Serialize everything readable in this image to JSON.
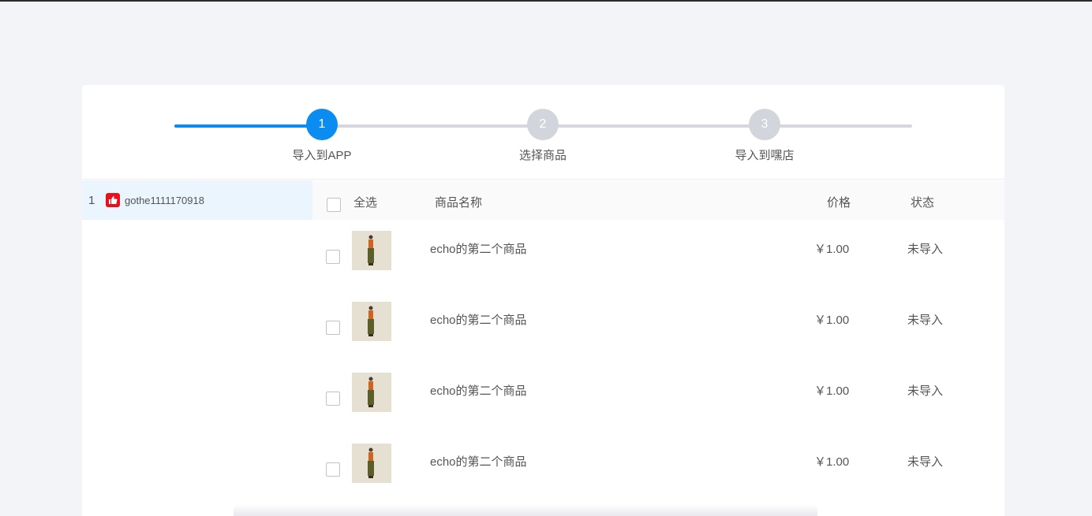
{
  "stepper": {
    "steps": [
      {
        "number": "1",
        "label": "导入到APP",
        "state": "active"
      },
      {
        "number": "2",
        "label": "选择商品",
        "state": "inactive"
      },
      {
        "number": "3",
        "label": "导入到嘿店",
        "state": "inactive"
      }
    ]
  },
  "shops": [
    {
      "index": "1",
      "icon": "thumbs-up-icon",
      "name": "gothe1111170918"
    }
  ],
  "table": {
    "select_all_label": "全选",
    "columns": {
      "name": "商品名称",
      "price": "价格",
      "status": "状态"
    },
    "rows": [
      {
        "name": "echo的第二个商品",
        "price": "￥1.00",
        "status": "未导入"
      },
      {
        "name": "echo的第二个商品",
        "price": "￥1.00",
        "status": "未导入"
      },
      {
        "name": "echo的第二个商品",
        "price": "￥1.00",
        "status": "未导入"
      },
      {
        "name": "echo的第二个商品",
        "price": "￥1.00",
        "status": "未导入"
      }
    ]
  },
  "colors": {
    "accent": "#0a8cf0",
    "inactive_step": "#d3d5dc",
    "selected_shop_bg": "#eaf5fe",
    "shop_icon": "#e8101a"
  }
}
